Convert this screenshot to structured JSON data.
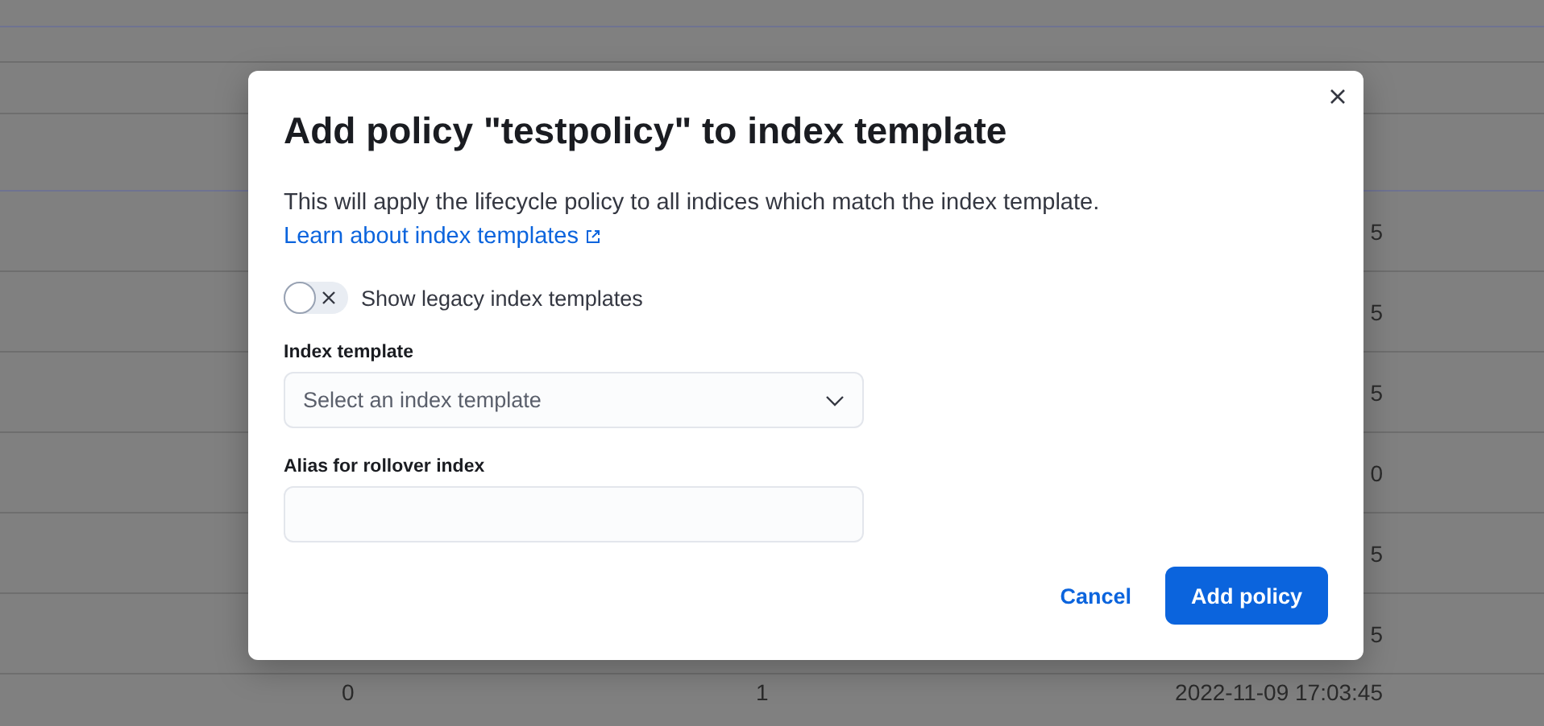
{
  "table": {
    "rows": [
      {
        "column_3": "5"
      },
      {
        "column_3": "5"
      },
      {
        "column_3": "5"
      },
      {
        "column_3": "0"
      },
      {
        "column_3": "5"
      },
      {
        "column_3": "5"
      },
      {
        "column_1": "0",
        "column_2": "1",
        "column_3": "2022-11-09 17:03:45"
      }
    ]
  },
  "modal": {
    "title": "Add policy \"testpolicy\" to index template",
    "description": "This will apply the lifecycle policy to all indices which match the index template.",
    "link": "Learn about index templates",
    "toggle": {
      "label": "Show legacy index templates",
      "checked": false
    },
    "fields": [
      {
        "kind": "select",
        "label": "Index template",
        "placeholder": "Select an index template"
      },
      {
        "kind": "text",
        "label": "Alias for rollover index"
      }
    ],
    "buttons": [
      {
        "kind": "link",
        "label": "Cancel"
      },
      {
        "kind": "primary",
        "label": "Add policy"
      }
    ]
  }
}
